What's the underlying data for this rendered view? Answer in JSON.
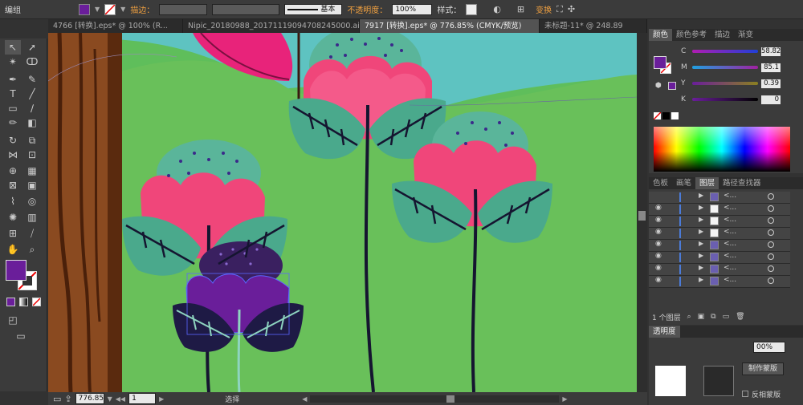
{
  "control_bar": {
    "group_label": "编组",
    "stroke_label": "描边：",
    "stroke_style_label": "基本",
    "opacity_label": "不透明度：",
    "opacity_value": "100%",
    "style_label": "样式：",
    "transform_label": "变换",
    "fill_color": "#6a1e9a"
  },
  "tabs": [
    {
      "label": "4766 [转换].eps* @ 100% (R..."
    },
    {
      "label": "Nipic_20180988_20171119094708245000.ai*"
    },
    {
      "label": "7917 [转换].eps* @ 776.85% (CMYK/预览)"
    },
    {
      "label": "未标题-11* @ 248.89"
    }
  ],
  "color_panel": {
    "tabs": [
      "颜色",
      "颜色参考",
      "描边",
      "渐变"
    ],
    "sliders": [
      {
        "label": "C",
        "value": "58.82"
      },
      {
        "label": "M",
        "value": "85.1"
      },
      {
        "label": "Y",
        "value": "0.39"
      },
      {
        "label": "K",
        "value": "0"
      }
    ]
  },
  "layers_panel": {
    "tabs": [
      "色板",
      "画笔",
      "图层",
      "路径查找器"
    ],
    "rows": [
      {
        "name": "<..."
      },
      {
        "name": "<..."
      },
      {
        "name": "<..."
      },
      {
        "name": "<..."
      },
      {
        "name": "<..."
      },
      {
        "name": "<..."
      },
      {
        "name": "<..."
      },
      {
        "name": "<..."
      }
    ],
    "footer": "1 个图层"
  },
  "transparency_panel": {
    "title": "透明度",
    "opacity_value": "00%",
    "make_mask_button": "制作蒙版",
    "invert_mask_label": "反相蒙版"
  },
  "status_bar": {
    "zoom": "776.85",
    "page": "1",
    "tool_label": "选择"
  }
}
